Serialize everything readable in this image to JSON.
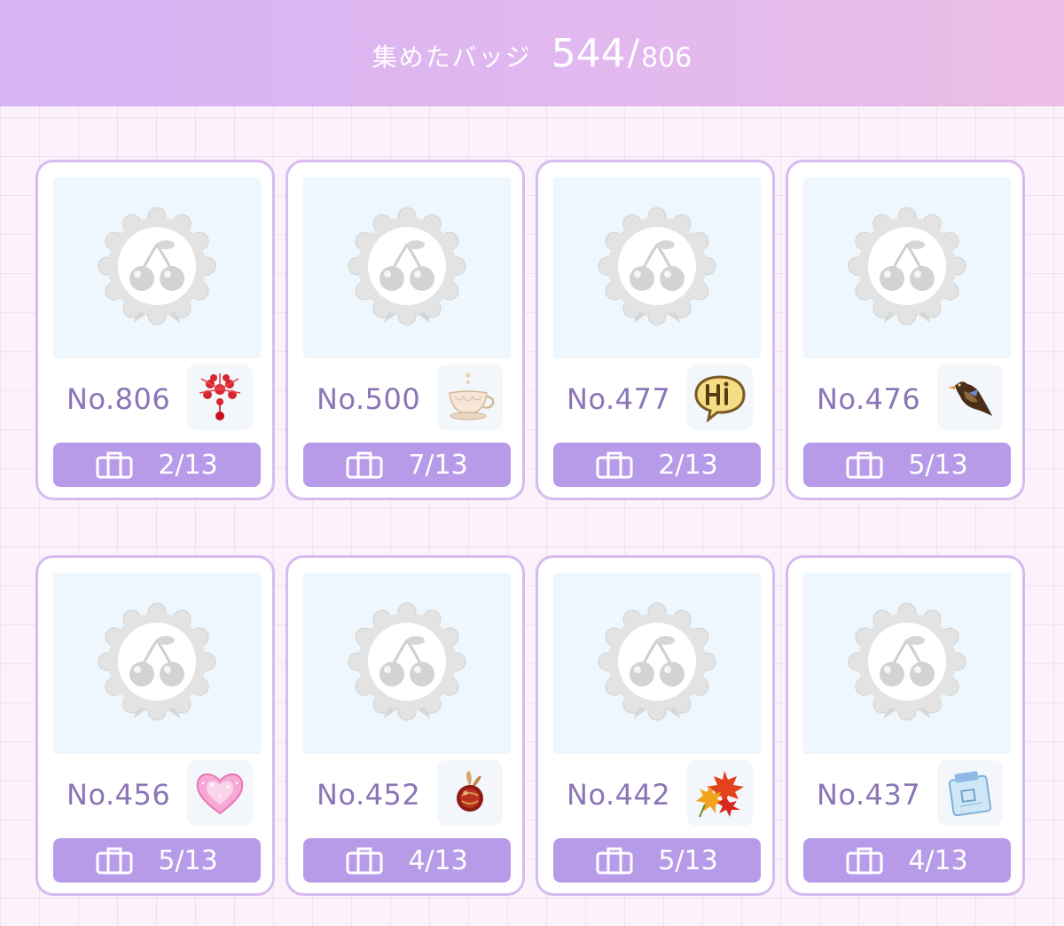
{
  "header": {
    "title": "集めたバッジ",
    "collected": "544",
    "slash": "/",
    "total": "806"
  },
  "colors": {
    "header_start": "#d6b3f3",
    "header_end": "#ecbde6",
    "accent": "#b89be8",
    "card_border": "#d6bcee",
    "number_text": "#8b75b5"
  },
  "cards": [
    {
      "number": "No.806",
      "icon": "red-flower-brooch-icon",
      "progress": "2/13"
    },
    {
      "number": "No.500",
      "icon": "teacup-icon",
      "progress": "7/13"
    },
    {
      "number": "No.477",
      "icon": "hi-speech-bubble-icon",
      "progress": "2/13"
    },
    {
      "number": "No.476",
      "icon": "bird-icon",
      "progress": "5/13"
    },
    {
      "number": "No.456",
      "icon": "pink-heart-gem-icon",
      "progress": "5/13"
    },
    {
      "number": "No.452",
      "icon": "red-ornament-charm-icon",
      "progress": "4/13"
    },
    {
      "number": "No.442",
      "icon": "autumn-maple-leaves-icon",
      "progress": "5/13"
    },
    {
      "number": "No.437",
      "icon": "blue-note-card-icon",
      "progress": "4/13"
    }
  ]
}
